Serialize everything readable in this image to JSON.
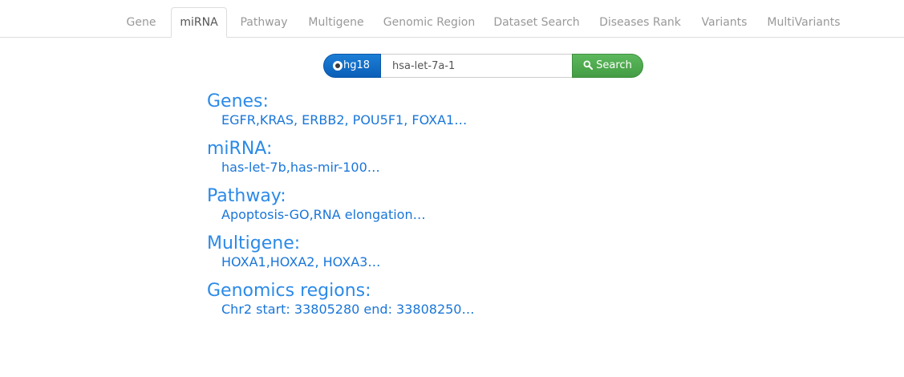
{
  "tabs": [
    {
      "label": "Gene",
      "active": false
    },
    {
      "label": "miRNA",
      "active": true
    },
    {
      "label": "Pathway",
      "active": false
    },
    {
      "label": "Multigene",
      "active": false
    },
    {
      "label": "Genomic Region",
      "active": false
    },
    {
      "label": "Dataset Search",
      "active": false
    },
    {
      "label": "Diseases Rank",
      "active": false
    },
    {
      "label": "Variants",
      "active": false
    },
    {
      "label": "MultiVariants",
      "active": false
    }
  ],
  "search": {
    "genome_label": "hg18",
    "value": "hsa-let-7a-1",
    "button_label": "Search"
  },
  "examples": {
    "genes": {
      "title": "Genes:",
      "value": "EGFR,KRAS, ERBB2, POU5F1, FOXA1…"
    },
    "mirna": {
      "title": "miRNA:",
      "value": "has-let-7b,has-mir-100…"
    },
    "pathway": {
      "title": "Pathway:",
      "value": "Apoptosis-GO,RNA elongation…"
    },
    "multigene": {
      "title": "Multigene:",
      "value": "HOXA1,HOXA2, HOXA3…"
    },
    "genomic_regions": {
      "title": "Genomics regions:",
      "value": "Chr2 start: 33805280 end: 33808250…"
    }
  },
  "colors": {
    "link": "#1a76d8",
    "genome_button": "#0b5fb8",
    "search_button": "#5cb85c"
  }
}
